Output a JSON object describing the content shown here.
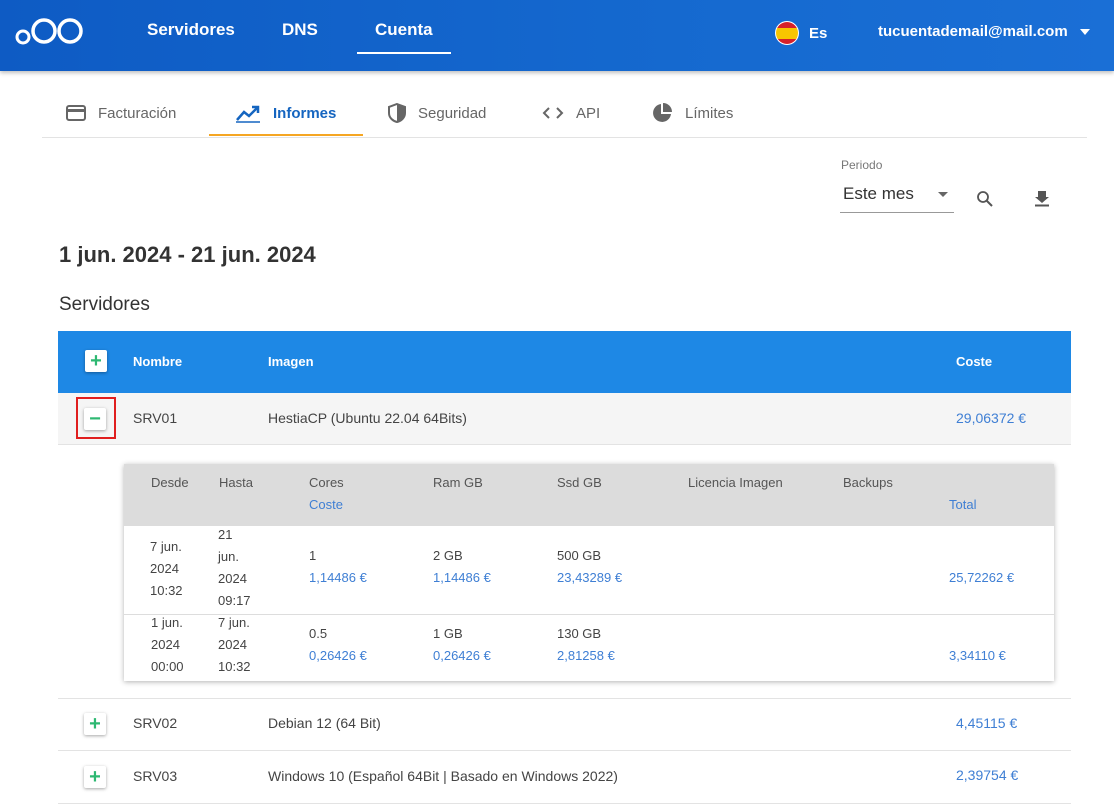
{
  "topnav": {
    "items": [
      {
        "label": "Servidores",
        "active": false
      },
      {
        "label": "DNS",
        "active": false
      },
      {
        "label": "Cuenta",
        "active": true
      }
    ],
    "language": "Es",
    "account_email": "tucuentademail@mail.com"
  },
  "subtabs": [
    {
      "label": "Facturación",
      "icon": "credit-card-icon"
    },
    {
      "label": "Informes",
      "icon": "trending-up-icon",
      "active": true
    },
    {
      "label": "Seguridad",
      "icon": "shield-icon"
    },
    {
      "label": "API",
      "icon": "code-icon"
    },
    {
      "label": "Límites",
      "icon": "pie-chart-icon"
    }
  ],
  "periodo": {
    "label": "Periodo",
    "value": "Este mes"
  },
  "date_range": "1 jun. 2024 - 21 jun. 2024",
  "section_title": "Servidores",
  "table": {
    "columns": {
      "nombre": "Nombre",
      "imagen": "Imagen",
      "coste": "Coste"
    },
    "rows": [
      {
        "name": "SRV01",
        "image": "HestiaCP (Ubuntu 22.04 64Bits)",
        "cost": "29,06372 €",
        "expanded": true
      },
      {
        "name": "SRV02",
        "image": "Debian 12 (64 Bit)",
        "cost": "4,45115 €",
        "expanded": false
      },
      {
        "name": "SRV03",
        "image": "Windows 10 (Español 64Bit | Basado en Windows 2022)",
        "cost": "2,39754 €",
        "expanded": false
      }
    ]
  },
  "detail": {
    "headers": {
      "desde": "Desde",
      "hasta": "Hasta",
      "cores": "Cores",
      "coste": "Coste",
      "ram": "Ram GB",
      "ssd": "Ssd GB",
      "licencia": "Licencia Imagen",
      "backups": "Backups",
      "total": "Total"
    },
    "rows": [
      {
        "desde": [
          "7 jun.",
          "2024",
          "10:32"
        ],
        "hasta": [
          "21",
          "jun.",
          "2024",
          "09:17"
        ],
        "cores": "1",
        "cores_cost": "1,14486 €",
        "ram": "2 GB",
        "ram_cost": "1,14486 €",
        "ssd": "500 GB",
        "ssd_cost": "23,43289 €",
        "total": "25,72262 €"
      },
      {
        "desde": [
          "1 jun.",
          "2024",
          "00:00"
        ],
        "hasta": [
          "7 jun.",
          "2024",
          "10:32"
        ],
        "cores": "0.5",
        "cores_cost": "0,26426 €",
        "ram": "1 GB",
        "ram_cost": "0,26426 €",
        "ssd": "130 GB",
        "ssd_cost": "2,81258 €",
        "total": "3,34110 €"
      }
    ]
  },
  "colors": {
    "primary": "#1565c0",
    "header_blue": "#1e88e5",
    "accent": "#f5a623",
    "link": "#3f7fd4",
    "toggle_green": "#2eb872"
  }
}
